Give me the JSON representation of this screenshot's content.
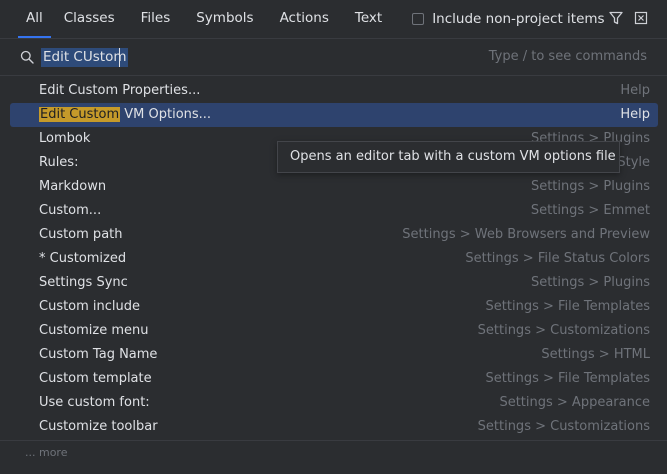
{
  "tabs": [
    {
      "label": "All",
      "active": true
    },
    {
      "label": "Classes"
    },
    {
      "label": "Files"
    },
    {
      "label": "Symbols"
    },
    {
      "label": "Actions"
    },
    {
      "label": "Text"
    }
  ],
  "include_non_project": {
    "label": "Include non-project items",
    "checked": false
  },
  "icons": {
    "filter": "filter-icon",
    "close": "close-icon",
    "search": "search-icon"
  },
  "search": {
    "value": "Edit CUstom",
    "hint": "Type / to see commands"
  },
  "results": [
    {
      "name": "Edit Custom Properties...",
      "location": "Help"
    },
    {
      "highlight": "Edit Custom",
      "rest": " VM Options...",
      "location": "Help",
      "selected": true
    },
    {
      "name": "Lombok",
      "location": "Settings > Plugins"
    },
    {
      "name": "Rules:",
      "location": "Style"
    },
    {
      "name": "Markdown",
      "location": "Settings > Plugins"
    },
    {
      "name": "Custom...",
      "location": "Settings > Emmet"
    },
    {
      "name": "Custom path",
      "location": "Settings > Web Browsers and Preview"
    },
    {
      "name": "* Customized",
      "location": "Settings > File Status Colors"
    },
    {
      "name": "Settings Sync",
      "location": "Settings > Plugins"
    },
    {
      "name": "Custom include",
      "location": "Settings > File Templates"
    },
    {
      "name": "Customize menu",
      "location": "Settings > Customizations"
    },
    {
      "name": "Custom Tag Name",
      "location": "Settings > HTML"
    },
    {
      "name": "Custom template",
      "location": "Settings > File Templates"
    },
    {
      "name": "Use custom font:",
      "location": "Settings > Appearance"
    },
    {
      "name": "Customize toolbar",
      "location": "Settings > Customizations"
    }
  ],
  "tooltip": "Opens an editor tab with a custom VM options file",
  "more_label": "... more",
  "colors": {
    "accent": "#3574f0",
    "selection": "#2e436e",
    "match_highlight": "#c59a2a",
    "background": "#2b2d30"
  }
}
